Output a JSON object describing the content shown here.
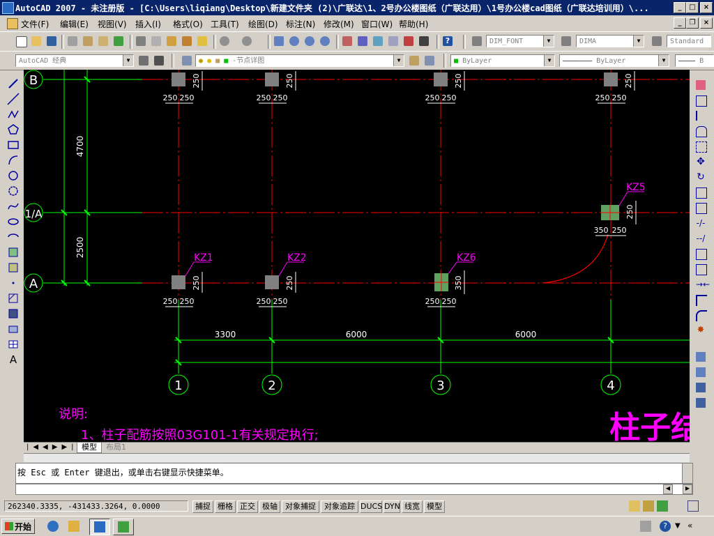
{
  "window": {
    "title": "AutoCAD 2007 - 未注册版 - [C:\\Users\\liqiang\\Desktop\\新建文件夹 (2)\\广联达\\1、2号办公楼图纸（广联达用）\\1号办公楼cad图纸（广联达培训用）\\...",
    "controls": [
      "_",
      "□",
      "×"
    ]
  },
  "menu": {
    "items": [
      "文件(F)",
      "编辑(E)",
      "视图(V)",
      "插入(I)",
      "格式(O)",
      "工具(T)",
      "绘图(D)",
      "标注(N)",
      "修改(M)",
      "窗口(W)",
      "帮助(H)"
    ]
  },
  "toolbar": {
    "text_style": "DIM_FONT",
    "dim_style": "DIMA",
    "table_style": "Standard",
    "workspace": "AutoCAD 经典",
    "layer": "-节点详图",
    "color": "ByLayer",
    "linetype": "ByLayer",
    "lineweight": "B"
  },
  "drawing": {
    "axes_h": [
      "B",
      "1/A",
      "A"
    ],
    "axes_v": [
      "1",
      "2",
      "3",
      "4"
    ],
    "dims_vertical": [
      "4700",
      "2500"
    ],
    "dims_horizontal": [
      "3300",
      "6000",
      "6000"
    ],
    "col_dim": "250",
    "col_dim_350": "350",
    "column_labels": [
      "KZ1",
      "KZ2",
      "KZ6",
      "KZ5"
    ],
    "note_title": "说明:",
    "note_line": "1、柱子配筋按照03G101-1有关规定执行;",
    "big_title": "柱子结"
  },
  "tabs": {
    "model": "模型",
    "layout1": "布局1"
  },
  "command": {
    "line": "按 Esc 或 Enter 键退出，或单击右键显示快捷菜单。"
  },
  "status": {
    "coords": "262340.3335, -431433.3264, 0.0000",
    "toggles": [
      "捕捉",
      "栅格",
      "正交",
      "极轴",
      "对象捕捉",
      "对象追踪",
      "DUCS",
      "DYN",
      "线宽",
      "模型"
    ]
  },
  "taskbar": {
    "start": "开始"
  },
  "colors": {
    "grid_red": "#ff0000",
    "axis_green": "#00ff00",
    "label_magenta": "#ff00ff",
    "bg": "#000000"
  }
}
